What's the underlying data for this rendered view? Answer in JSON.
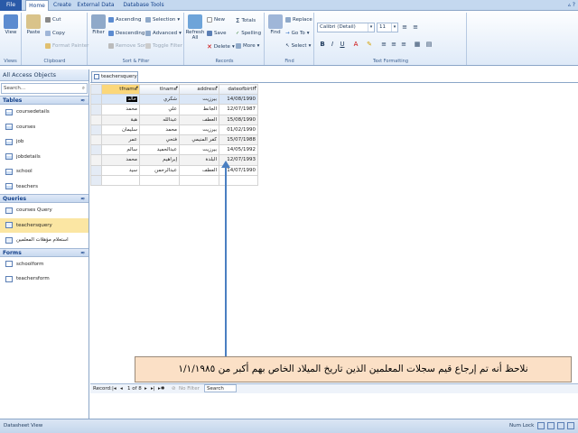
{
  "tabs": [
    "File",
    "Home",
    "Create",
    "External Data",
    "Database Tools"
  ],
  "ribbon": {
    "views": {
      "view": "View",
      "label": "Views"
    },
    "clipboard": {
      "paste": "Paste",
      "cut": "Cut",
      "copy": "Copy",
      "painter": "Format Painter",
      "label": "Clipboard"
    },
    "sortfilter": {
      "filter": "Filter",
      "asc": "Ascending",
      "desc": "Descending",
      "remove": "Remove Sort",
      "selection": "Selection",
      "advanced": "Advanced",
      "toggle": "Toggle Filter",
      "label": "Sort & Filter"
    },
    "records": {
      "refresh": "Refresh All",
      "new": "New",
      "save": "Save",
      "delete": "Delete",
      "totals": "Totals",
      "spelling": "Spelling",
      "more": "More",
      "label": "Records"
    },
    "find": {
      "find": "Find",
      "replace": "Replace",
      "goto": "Go To",
      "select": "Select",
      "label": "Find"
    },
    "text": {
      "font": "Calibri (Detail)",
      "size": "11",
      "label": "Text Formatting",
      "b": "B",
      "i": "I",
      "u": "U"
    }
  },
  "nav": {
    "title": "All Access Objects",
    "search": "Search...",
    "sections": [
      {
        "name": "Tables",
        "items": [
          "coursedetails",
          "courses",
          "job",
          "jobdetails",
          "school",
          "teachers"
        ]
      },
      {
        "name": "Queries",
        "items": [
          "courses Query",
          "teachersquery",
          "استعلام مؤهلات المعلمين"
        ]
      },
      {
        "name": "Forms",
        "items": [
          "schoolform",
          "teachersform"
        ]
      }
    ]
  },
  "doc": {
    "tab": "teachersquery"
  },
  "grid": {
    "columns": [
      "tfname",
      "tlname",
      "address",
      "dateofbirth"
    ],
    "rows": [
      [
        "خالد",
        "شكري",
        "بيرزيت",
        "14/08/1990"
      ],
      [
        "محمد",
        "علي",
        "الجانط",
        "12/07/1987"
      ],
      [
        "هبة",
        "عبدالله",
        "العطف",
        "15/08/1990"
      ],
      [
        "سليمان",
        "محمد",
        "بيرزيت",
        "01/02/1990"
      ],
      [
        "عمر",
        "فتحي",
        "كفر المنيمي",
        "15/07/1988"
      ],
      [
        "سالم",
        "عبدالحميد",
        "بيرزيت",
        "14/05/1992"
      ],
      [
        "محمد",
        "إبراهيم",
        "البلدة",
        "12/07/1993"
      ],
      [
        "سيد",
        "عبدالرحمن",
        "العطف",
        "14/07/1990"
      ]
    ]
  },
  "note": "نلاحظ أنه تم إرجاع قيم سجلات المعلمين الذين تاريخ الميلاد الخاص بهم أكبر من ١/١/١٩٨٥",
  "recnav": {
    "label": "Record:",
    "pos": "1 of 8",
    "filter": "No Filter",
    "search": "Search"
  },
  "status": {
    "left": "Datasheet View",
    "right": "Num Lock"
  }
}
